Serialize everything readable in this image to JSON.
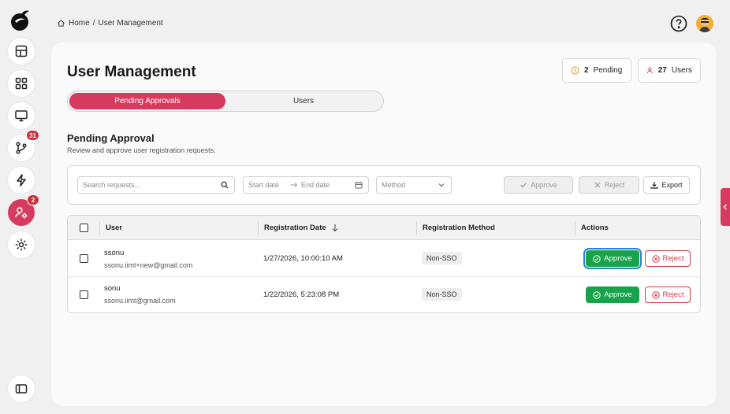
{
  "breadcrumb": {
    "home": "Home",
    "separator": "/",
    "current": "User Management"
  },
  "sidebar": {
    "badges": {
      "requests": "31",
      "users": "2"
    }
  },
  "page": {
    "title": "User Management"
  },
  "stats": {
    "pending_count": "2",
    "pending_label": "Pending",
    "users_count": "27",
    "users_label": "Users"
  },
  "tabs": [
    {
      "label": "Pending Approvals",
      "active": true
    },
    {
      "label": "Users",
      "active": false
    }
  ],
  "section": {
    "title": "Pending Approval",
    "subtitle": "Review and approve user registration requests."
  },
  "filters": {
    "search_placeholder": "Search requests...",
    "start_date_placeholder": "Start date",
    "end_date_placeholder": "End date",
    "method_placeholder": "Method",
    "approve_label": "Approve",
    "reject_label": "Reject",
    "export_label": "Export"
  },
  "table": {
    "headers": [
      "User",
      "Registration Date",
      "Registration Method",
      "Actions"
    ],
    "rows": [
      {
        "name": "ssonu",
        "email": "ssonu.iimt+new@gmail.com",
        "date": "1/27/2026, 10:00:10 AM",
        "method": "Non-SSO",
        "approve": "Approve",
        "reject": "Reject"
      },
      {
        "name": "sonu",
        "email": "ssonu.iimt@gmail.com",
        "date": "1/22/2026, 5:23:08 PM",
        "method": "Non-SSO",
        "approve": "Approve",
        "reject": "Reject"
      }
    ]
  },
  "colors": {
    "accent": "#d63a5e",
    "approve": "#18a34a",
    "reject": "#d23c4a",
    "badge": "#c8323c"
  }
}
